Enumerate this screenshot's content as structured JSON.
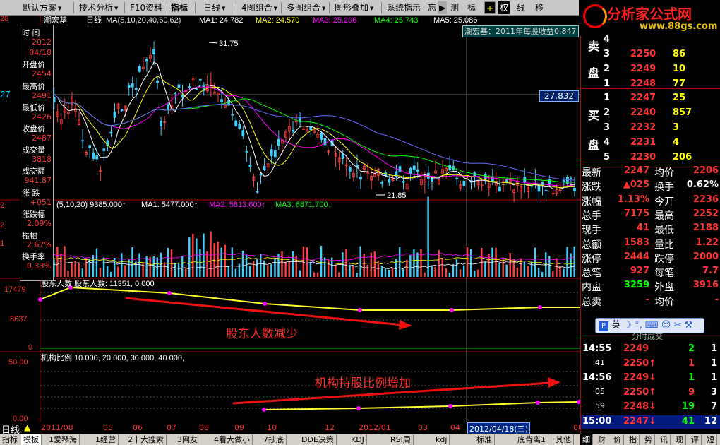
{
  "toolbar": {
    "items": [
      "默认方案",
      "技术分析",
      "F10资料",
      "指标",
      "日线",
      "4图组合",
      "多图组合",
      "图形叠加",
      "系统指示",
      "忘",
      "测",
      "标",
      "权",
      "线",
      "移"
    ],
    "logo_title": "分析家公式网",
    "logo_url": "www.88gs.com"
  },
  "chart": {
    "stock_name": "潮宏基",
    "period": "日线",
    "ma_line": "MA(5,10,20,40,60,62)",
    "ma1": "MA1: 24.782",
    "ma2": "MA2: 24.570",
    "ma3": "MA3: 25.206",
    "ma4": "MA4: 25.743",
    "ma5": "MA5: 25.086",
    "high_label": "31.75",
    "low_label": "21.85",
    "price_badge": "27.832",
    "left_price": "27",
    "vol_line": "(5,10,20)  9385.000↑",
    "vol_ma1": "MA1: 5477.000↑",
    "vol_ma2": "MA2: 5813.600↑",
    "vol_ma3": "MA3: 6871.700↓",
    "news": "潮宏基：2011年每股收益0.847",
    "holder_title": "股东人数  股东人数: 11351,  0.000",
    "holder_y1": "17479",
    "holder_y2": "8637",
    "holder_y3": "0",
    "holder_note": "股东人数减少",
    "inst_title": "机构比例  10.000,  20.000,  30.000,  40.000,",
    "inst_y1": "50.00",
    "inst_y2": "0.00",
    "inst_note": "机构持股比例增加",
    "left_vals": [
      "2",
      "2",
      "1",
      "0.33"
    ],
    "left_top": "20",
    "dates": [
      "2011/08",
      "05",
      "06",
      "07",
      "08",
      "09",
      "10",
      "12",
      "2012/01",
      "03",
      "04",
      "2012/04/18(三)",
      "08"
    ],
    "period_label": "日线"
  },
  "info": [
    {
      "l": "时  间",
      "v": ""
    },
    {
      "l": "",
      "v": "2012"
    },
    {
      "l": "",
      "v": "04/18"
    },
    {
      "l": "开盘价",
      "v": ""
    },
    {
      "l": "",
      "v": "2454"
    },
    {
      "l": "最高价",
      "v": ""
    },
    {
      "l": "",
      "v": "2491"
    },
    {
      "l": "最低价",
      "v": ""
    },
    {
      "l": "",
      "v": "2426"
    },
    {
      "l": "收盘价",
      "v": ""
    },
    {
      "l": "",
      "v": "2487"
    },
    {
      "l": "成交量",
      "v": ""
    },
    {
      "l": "",
      "v": "3818"
    },
    {
      "l": "成交额",
      "v": ""
    },
    {
      "l": "",
      "v": "941.87"
    },
    {
      "l": "涨  跌",
      "v": ""
    },
    {
      "l": "",
      "v": "+051"
    },
    {
      "l": "涨跌幅",
      "v": ""
    },
    {
      "l": "",
      "v": "2.09%"
    },
    {
      "l": "振幅",
      "v": ""
    },
    {
      "l": "",
      "v": "2.67%"
    },
    {
      "l": "换手率",
      "v": ""
    },
    {
      "l": "",
      "v": "0.33%"
    }
  ],
  "orderbook": {
    "sell_label": [
      "卖",
      "盘"
    ],
    "buy_label": [
      "买",
      "盘"
    ],
    "sell": [
      [
        "4",
        "",
        ""
      ],
      [
        "3",
        "2250",
        "86"
      ],
      [
        "2",
        "2249",
        "10"
      ],
      [
        "1",
        "2248",
        "77"
      ]
    ],
    "buy": [
      [
        "1",
        "2247",
        "25"
      ],
      [
        "2",
        "2240",
        "857"
      ],
      [
        "3",
        "2232",
        "3"
      ],
      [
        "4",
        "2231",
        "4"
      ],
      [
        "5",
        "2230",
        "206"
      ]
    ]
  },
  "quote": [
    [
      "最新",
      "2247",
      "均价",
      "2206"
    ],
    [
      "涨跌",
      "▲025",
      "换手",
      "0.62%"
    ],
    [
      "涨幅",
      "1.13%",
      "今开",
      "2236"
    ],
    [
      "总手",
      "7175",
      "最高",
      "2252"
    ],
    [
      "现手",
      "41",
      "最低",
      "2188"
    ],
    [
      "总额",
      "1583",
      "量比",
      "1.22"
    ],
    [
      "涨停",
      "2444",
      "跌停",
      "2000"
    ],
    [
      "总笔",
      "927",
      "每笔",
      "7.7"
    ],
    [
      "内盘",
      "3259",
      "外盘",
      "3916"
    ],
    [
      "总卖",
      "-",
      "均价",
      "-"
    ]
  ],
  "panel": {
    "text": "英",
    "subtitle": "分时成交"
  },
  "ticks": [
    [
      "14:55",
      "2249",
      "2",
      "1"
    ],
    [
      "41",
      "2250↑",
      "1",
      "1"
    ],
    [
      "14:56",
      "2249↓",
      "1",
      "1"
    ],
    [
      "05",
      "2250↑",
      "9",
      "3"
    ],
    [
      "59",
      "2248↓",
      "19",
      "7"
    ],
    [
      "15:00",
      "2247↓",
      "41",
      "12"
    ]
  ],
  "bottom_tabs": [
    "指标",
    "模板",
    "1爱琴海",
    "1经营",
    "2十大搜索",
    "3网友",
    "4看大做小",
    "7抄底",
    "DDE决策",
    "KDJ",
    "RSI周",
    "kdj",
    "标准",
    "底背离1",
    "其他"
  ],
  "right_tabs": [
    "细",
    "财",
    "价",
    "指",
    "势",
    "讯",
    "现",
    "评",
    "短"
  ]
}
